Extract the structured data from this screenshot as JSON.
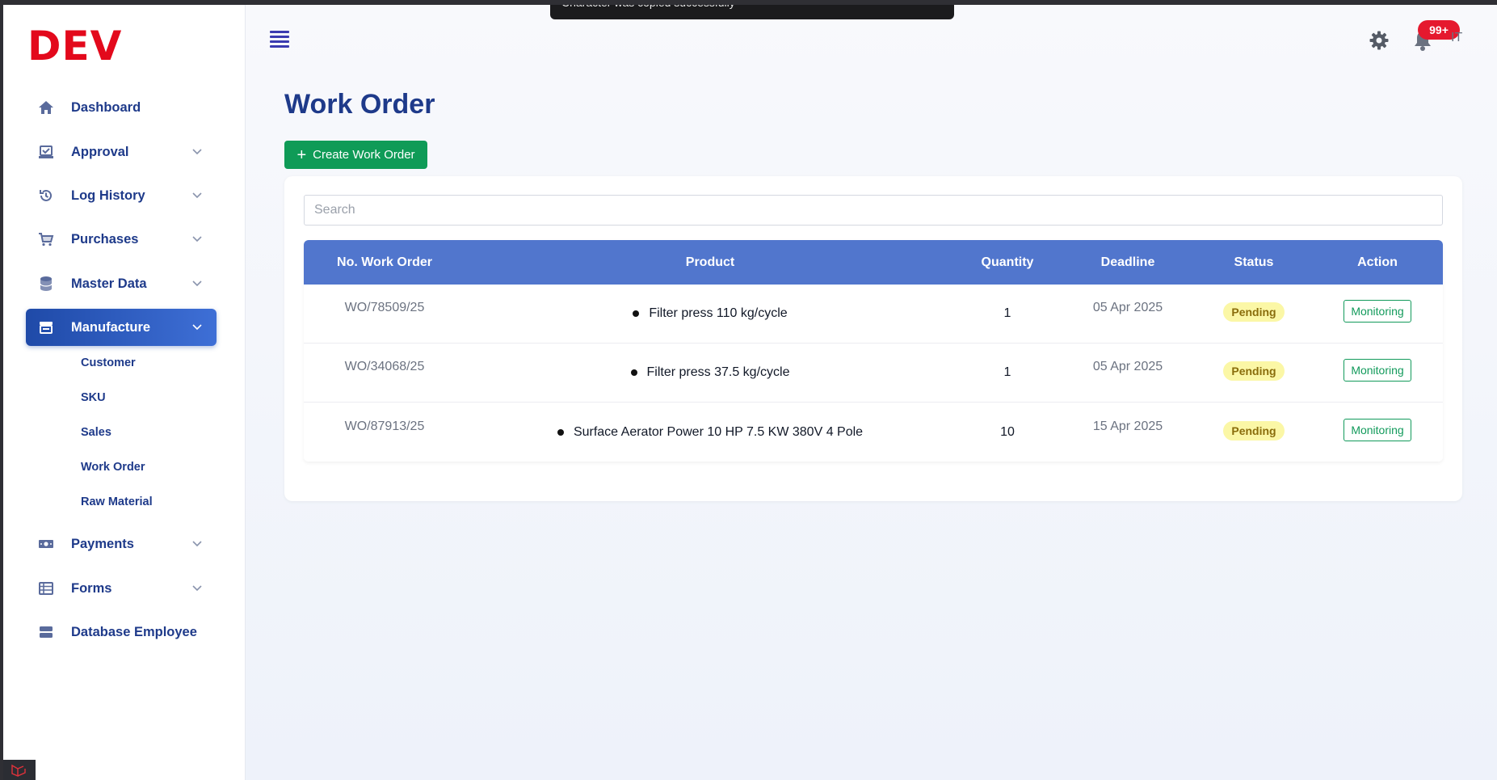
{
  "toast": {
    "message": "Character was copied successfully"
  },
  "brand": {
    "logo": "DEV"
  },
  "sidebar": {
    "items": [
      {
        "label": "Dashboard",
        "icon": "home-icon",
        "has_chevron": false
      },
      {
        "label": "Approval",
        "icon": "approval-icon",
        "has_chevron": true
      },
      {
        "label": "Log History",
        "icon": "history-icon",
        "has_chevron": true
      },
      {
        "label": "Purchases",
        "icon": "cart-icon",
        "has_chevron": true
      },
      {
        "label": "Master Data",
        "icon": "database-icon",
        "has_chevron": true
      },
      {
        "label": "Manufacture",
        "icon": "store-icon",
        "has_chevron": true,
        "active": true
      },
      {
        "label": "Payments",
        "icon": "money-icon",
        "has_chevron": true
      },
      {
        "label": "Forms",
        "icon": "table-icon",
        "has_chevron": true
      },
      {
        "label": "Database Employee",
        "icon": "server-icon",
        "has_chevron": false
      }
    ],
    "manufacture_sub": [
      "Customer",
      "SKU",
      "Sales",
      "Work Order",
      "Raw Material"
    ]
  },
  "header": {
    "notification_count": "99+",
    "avatar_initial": "IT"
  },
  "main": {
    "title": "Work Order",
    "create_button": "Create Work Order",
    "search_placeholder": "Search",
    "columns": [
      "No. Work Order",
      "Product",
      "Quantity",
      "Deadline",
      "Status",
      "Action"
    ],
    "rows": [
      {
        "wo": "WO/78509/25",
        "product": "Filter press 110 kg/cycle",
        "quantity": "1",
        "deadline": "05 Apr 2025",
        "status": "Pending",
        "action": "Monitoring"
      },
      {
        "wo": "WO/34068/25",
        "product": "Filter press 37.5 kg/cycle",
        "quantity": "1",
        "deadline": "05 Apr 2025",
        "status": "Pending",
        "action": "Monitoring"
      },
      {
        "wo": "WO/87913/25",
        "product": "Surface Aerator Power 10 HP 7.5 KW 380V 4 Pole",
        "quantity": "10",
        "deadline": "15 Apr 2025",
        "status": "Pending",
        "action": "Monitoring"
      }
    ]
  },
  "colors": {
    "brand_red": "#e3091c",
    "nav_text": "#1e3a8a",
    "active_nav": "#2a56bd",
    "table_header": "#5176cd",
    "create_button": "#0f9b57",
    "pending_badge": "#fbf7a6",
    "notification_badge": "#e5192e"
  }
}
